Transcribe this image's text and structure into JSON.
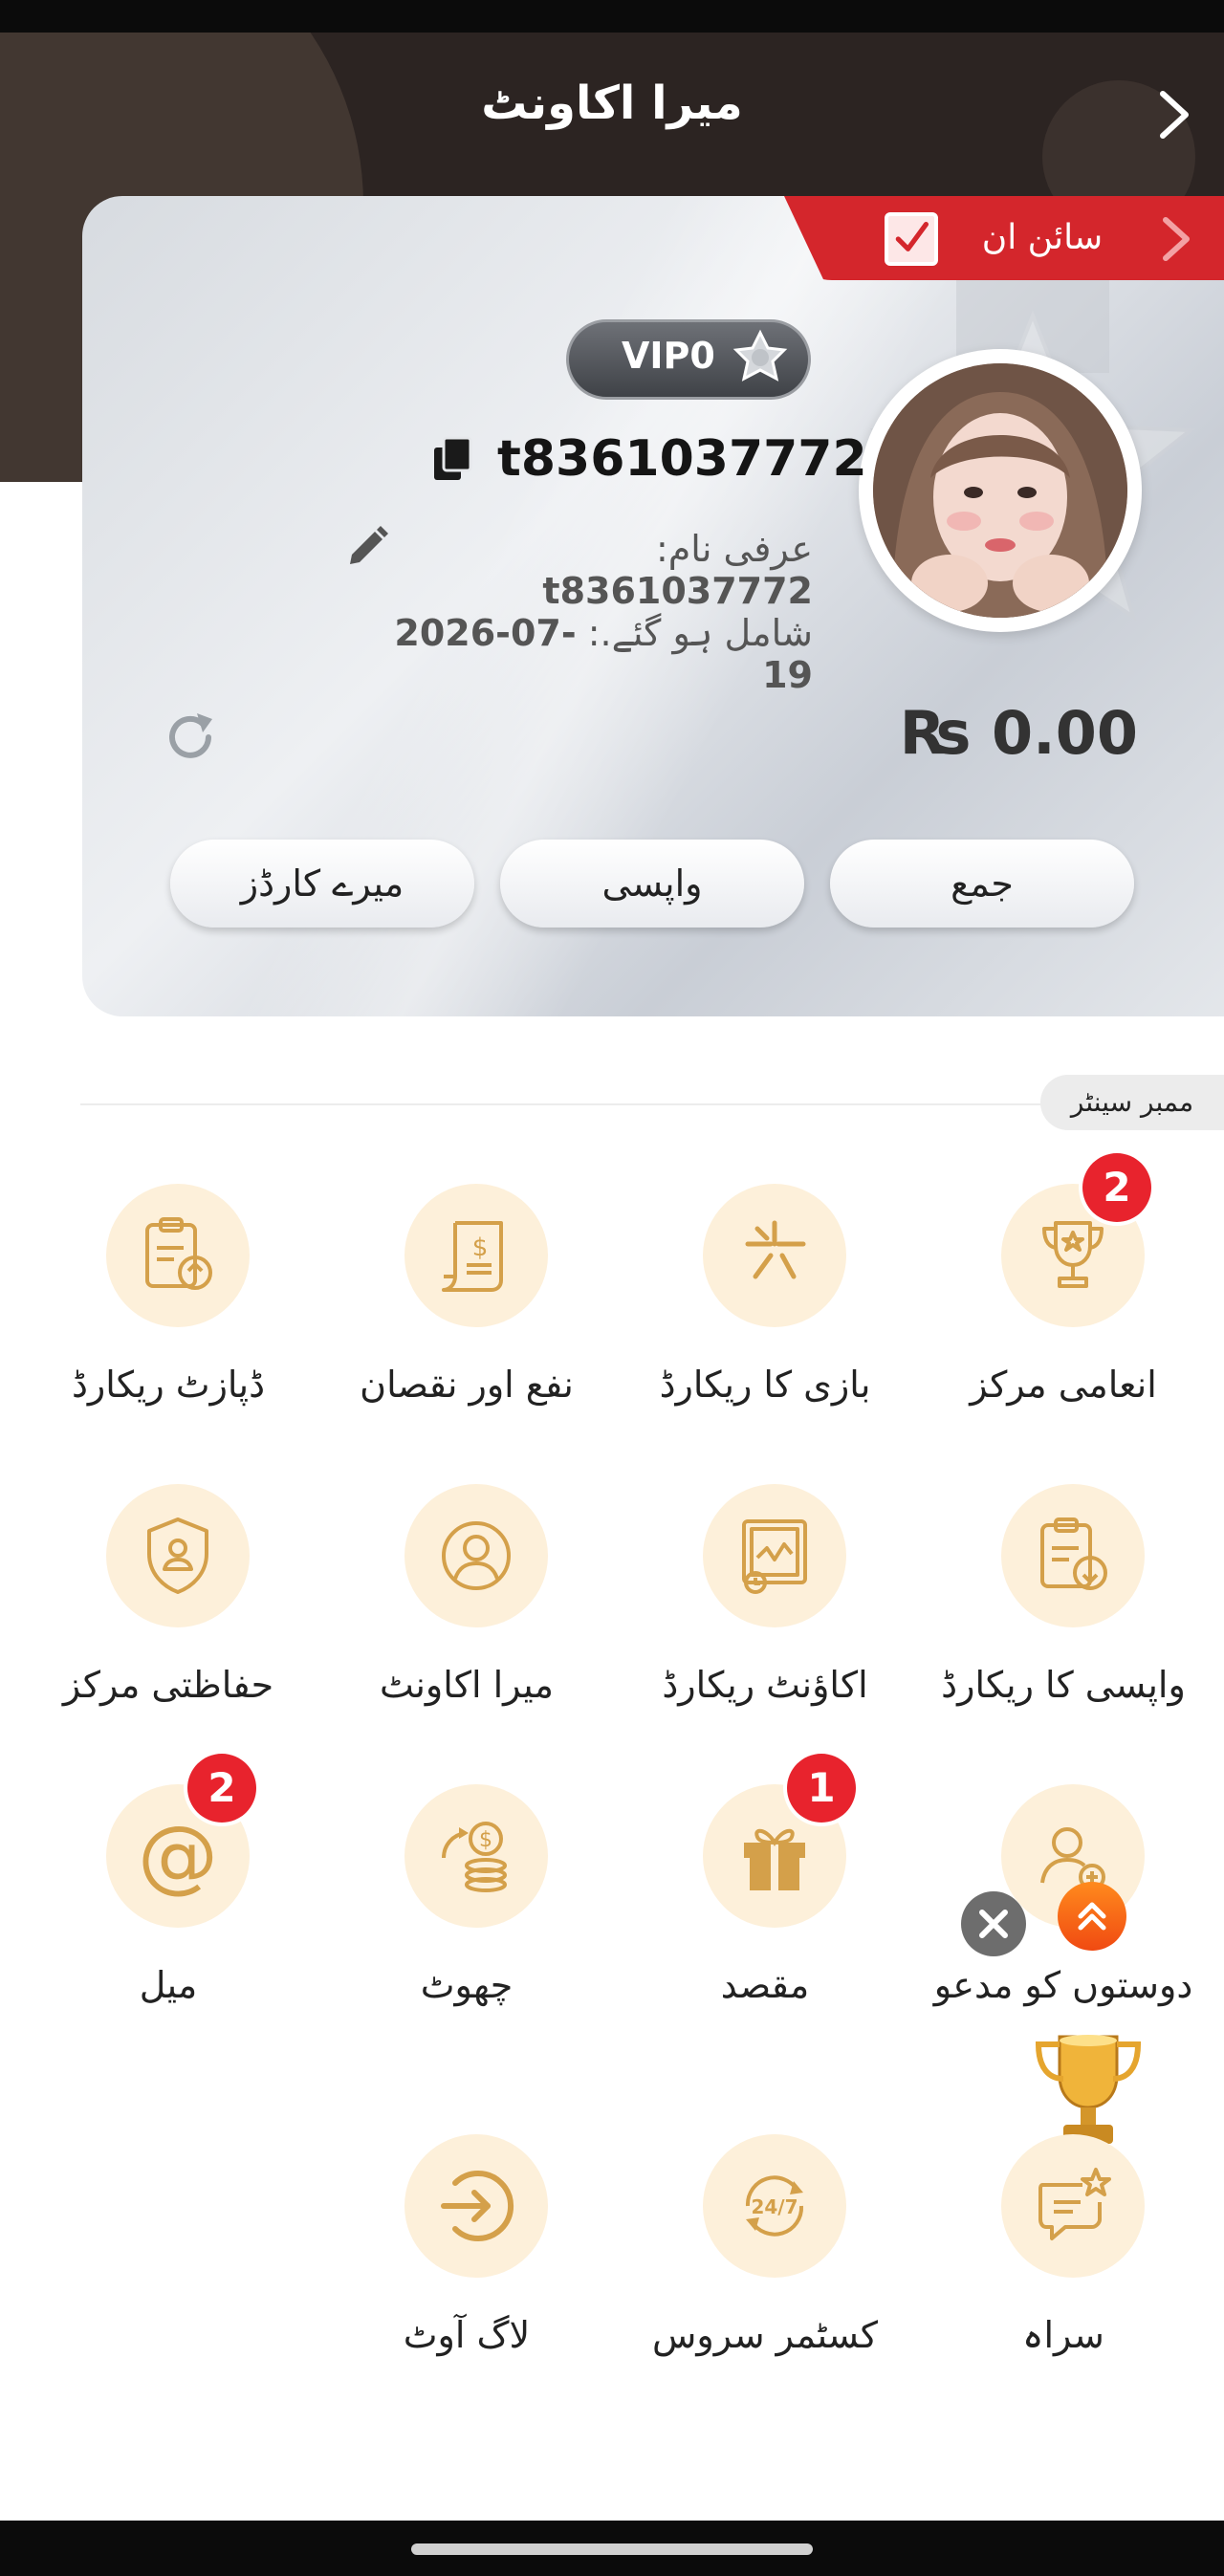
{
  "header": {
    "title": "میرا اکاونٹ"
  },
  "signin": {
    "label": "سائن ان"
  },
  "profile": {
    "vip": "VIP0",
    "username": "t8361037772",
    "nickname_label": "عرفی نام:",
    "nickname": "t8361037772",
    "joined_label": "شامل ہو گئے.:",
    "joined_date": "2026-07-19",
    "balance": "₨ 0.00"
  },
  "actions": {
    "deposit": "جمع",
    "withdraw": "واپسی",
    "cards": "میرے کارڈز"
  },
  "member_center": {
    "label": "ممبر سینٹر"
  },
  "menu": [
    {
      "label": "انعامی مرکز",
      "icon": "trophy-icon",
      "badge": "2"
    },
    {
      "label": "بازی کا ریکارڈ",
      "icon": "game-record-icon"
    },
    {
      "label": "نفع اور نقصان",
      "icon": "profit-loss-icon"
    },
    {
      "label": "ڈپازٹ ریکارڈ",
      "icon": "deposit-record-icon"
    },
    {
      "label": "واپسی کا ریکارڈ",
      "icon": "withdraw-record-icon"
    },
    {
      "label": "اکاؤنٹ ریکارڈ",
      "icon": "account-record-icon"
    },
    {
      "label": "میرا اکاونٹ",
      "icon": "user-icon"
    },
    {
      "label": "حفاظتی مرکز",
      "icon": "shield-icon"
    },
    {
      "label": "دوستوں کو مدعو",
      "icon": "invite-friends-icon"
    },
    {
      "label": "مقصد",
      "icon": "gift-icon",
      "badge": "1"
    },
    {
      "label": "چھوٹ",
      "icon": "coins-icon"
    },
    {
      "label": "میل",
      "icon": "mail-at-icon",
      "badge": "2"
    },
    {
      "label": "سراہ",
      "icon": "feedback-icon"
    },
    {
      "label": "کسٹمر سروس",
      "icon": "support-24-7-icon"
    },
    {
      "label": "لاگ آوٹ",
      "icon": "logout-icon"
    }
  ],
  "colors": {
    "accent": "#d4262c",
    "icon_bg": "#fdf0da",
    "icon_stroke": "#d4a04a",
    "header_bg": "#2c2422"
  }
}
